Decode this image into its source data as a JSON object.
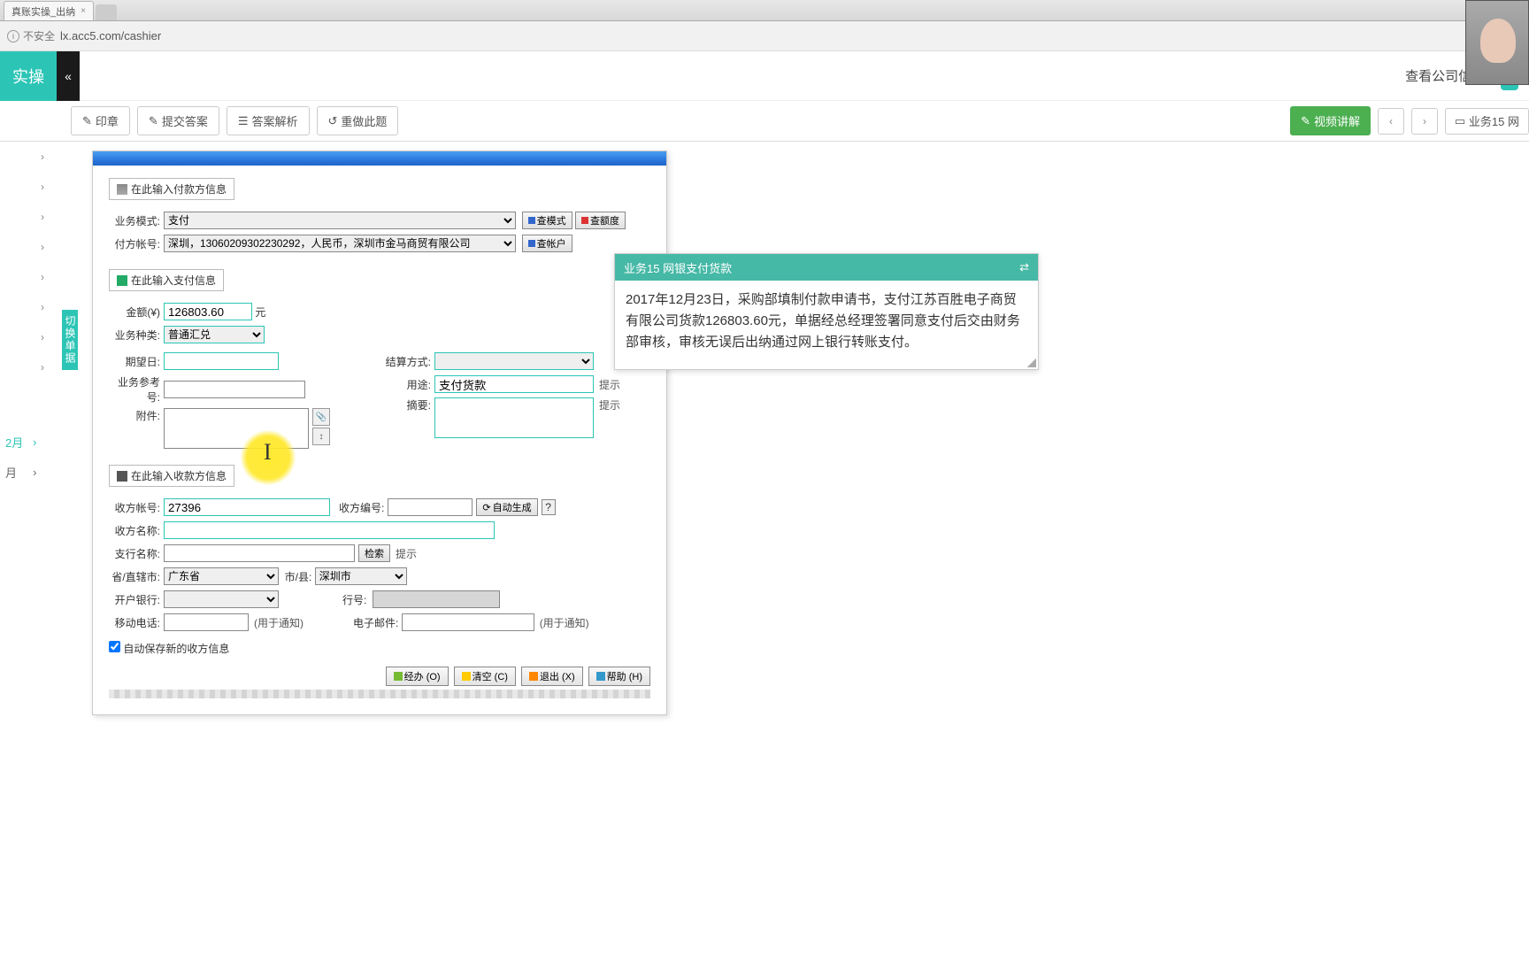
{
  "browser": {
    "tab_title": "真账实操_出纳",
    "insecure_label": "不安全",
    "url": "lx.acc5.com/cashier"
  },
  "header": {
    "left_badge": "实操",
    "view_company": "查看公司信息"
  },
  "toolbar": {
    "stamp": "印章",
    "submit": "提交答案",
    "analysis": "答案解析",
    "redo": "重做此题",
    "video": "视频讲解",
    "breadcrumb": "业务15 网"
  },
  "side_tab": "切换单据",
  "sidebar_months": {
    "m12": "2月",
    "m_other": "月"
  },
  "panel": {
    "section1_title": "在此输入付款方信息",
    "biz_mode_label": "业务模式:",
    "biz_mode_value": "支付",
    "btn_view_mode": "查模式",
    "btn_view_quota": "查额度",
    "payer_acct_label": "付方帐号:",
    "payer_acct_value": "深圳，13060209302230292，人民币，深圳市金马商贸有限公司",
    "btn_view_acct": "查帐户",
    "section2_title": "在此输入支付信息",
    "amount_label": "金额(¥)",
    "amount_value": "126803.60",
    "amount_unit": "元",
    "biz_type_label": "业务种类:",
    "biz_type_value": "普通汇兑",
    "expect_date_label": "期望日:",
    "settle_label": "结算方式:",
    "biz_ref_label": "业务参考号:",
    "purpose_label": "用途:",
    "purpose_value": "支付货款",
    "hint": "提示",
    "attach_label": "附件:",
    "summary_label": "摘要:",
    "section3_title": "在此输入收款方信息",
    "recv_acct_label": "收方帐号:",
    "recv_acct_value": "27396",
    "recv_no_label": "收方编号:",
    "auto_gen": "自动生成",
    "recv_name_label": "收方名称:",
    "branch_label": "支行名称:",
    "search_btn": "检索",
    "prov_label": "省/直辖市:",
    "prov_value": "广东省",
    "city_label": "市/县:",
    "city_value": "深圳市",
    "bank_label": "开户银行:",
    "bank_code_label": "行号:",
    "mobile_label": "移动电话:",
    "notify": "(用于通知)",
    "email_label": "电子邮件:",
    "auto_save": "自动保存新的收方信息",
    "btn_process": "经办 (O)",
    "btn_clear": "清空 (C)",
    "btn_exit": "退出 (X)",
    "btn_help": "帮助 (H)"
  },
  "task": {
    "title": "业务15 网银支付货款",
    "body": "2017年12月23日，采购部填制付款申请书，支付江苏百胜电子商贸有限公司货款126803.60元，单据经总经理签署同意支付后交由财务部审核，审核无误后出纳通过网上银行转账支付。"
  }
}
